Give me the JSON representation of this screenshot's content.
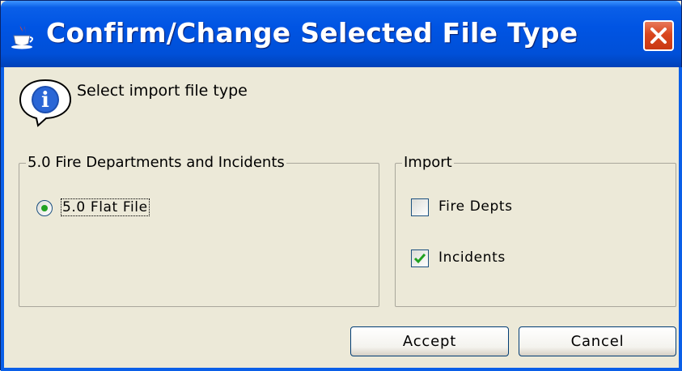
{
  "window": {
    "title": "Confirm/Change Selected File Type",
    "title_icon": "java-cup-icon",
    "close_icon": "close-icon"
  },
  "header": {
    "icon": "info-icon",
    "message": "Select import file type"
  },
  "file_type_group": {
    "title": "5.0 Fire Departments and Incidents",
    "option_label": "5.0 Flat File",
    "option_selected": true
  },
  "import_group": {
    "title": "Import",
    "items": [
      {
        "label": "Fire Depts",
        "checked": false
      },
      {
        "label": "Incidents",
        "checked": true
      }
    ]
  },
  "buttons": {
    "accept": "Accept",
    "cancel": "Cancel"
  },
  "colors": {
    "titlebar": "#0054E3",
    "dialog_bg": "#ECE9D8",
    "close_button": "#D9461E",
    "check_mark": "#21A121"
  }
}
